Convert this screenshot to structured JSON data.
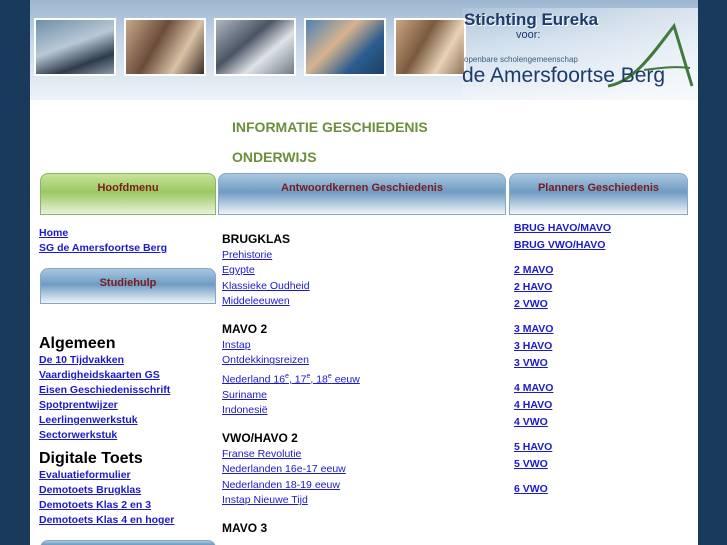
{
  "header": {
    "logo_title": "Stichting Eureka",
    "logo_voor": "voor:",
    "logo_sub": "openbare scholengemeenschap",
    "logo_berg": "de Amersfoortse Berg"
  },
  "page_title": {
    "line1": "INFORMATIE GESCHIEDENIS",
    "line2": "ONDERWIJS"
  },
  "tabs": {
    "hoofdmenu": "Hoofdmenu",
    "antwoordkernen": "Antwoordkernen Geschiedenis",
    "planners": "Planners Geschiedenis",
    "studiehulp": "Studiehulp"
  },
  "left": {
    "main_links": [
      "Home",
      "SG de Amersfoortse Berg"
    ],
    "algemeen_heading": "Algemeen",
    "algemeen_links": [
      "De 10 Tijdvakken",
      "Vaardigheidskaarten GS",
      "Eisen Geschiedenisschrift",
      "Spotprentwijzer",
      "Leerlingenwerkstuk",
      "Sectorwerkstuk"
    ],
    "digitale_heading": "Digitale Toets",
    "digitale_links": [
      "Evaluatieformulier",
      "Demotoets Brugklas",
      "Demotoets Klas 2 en 3",
      "Demotoets Klas 4 en hoger"
    ]
  },
  "middle": {
    "brugklas": {
      "title": "BRUGKLAS",
      "links": [
        "Prehistorie",
        "Egypte",
        "Klassieke Oudheid",
        "Middeleeuwen"
      ]
    },
    "mavo2": {
      "title": "MAVO 2",
      "links": [
        "Instap",
        "Ontdekkingsreizen",
        "Suriname",
        "Indonesië"
      ],
      "nederland": {
        "prefix": "Nederland 16",
        "sup1": "e",
        "mid1": ", 17",
        "sup2": "e",
        "mid2": ", 18",
        "sup3": "e",
        "suffix": " eeuw"
      }
    },
    "vwohavo2": {
      "title": "VWO/HAVO 2",
      "links": [
        "Franse Revolutie",
        "Nederlanden 16e-17 eeuw",
        "Nederlanden 18-19 eeuw",
        "Instap Nieuwe Tijd"
      ]
    },
    "mavo3": {
      "title": "MAVO 3"
    }
  },
  "right": {
    "group1": [
      "BRUG HAVO/MAVO",
      "BRUG VWO/HAVO"
    ],
    "group2": [
      "2 MAVO",
      "2 HAVO",
      "2 VWO"
    ],
    "group3": [
      "3 MAVO",
      "3 HAVO",
      "3 VWO"
    ],
    "group4": [
      "4 MAVO",
      "4 HAVO",
      "4 VWO"
    ],
    "group5": [
      "5 HAVO",
      "5 VWO"
    ],
    "group6": [
      "6 VWO"
    ]
  }
}
